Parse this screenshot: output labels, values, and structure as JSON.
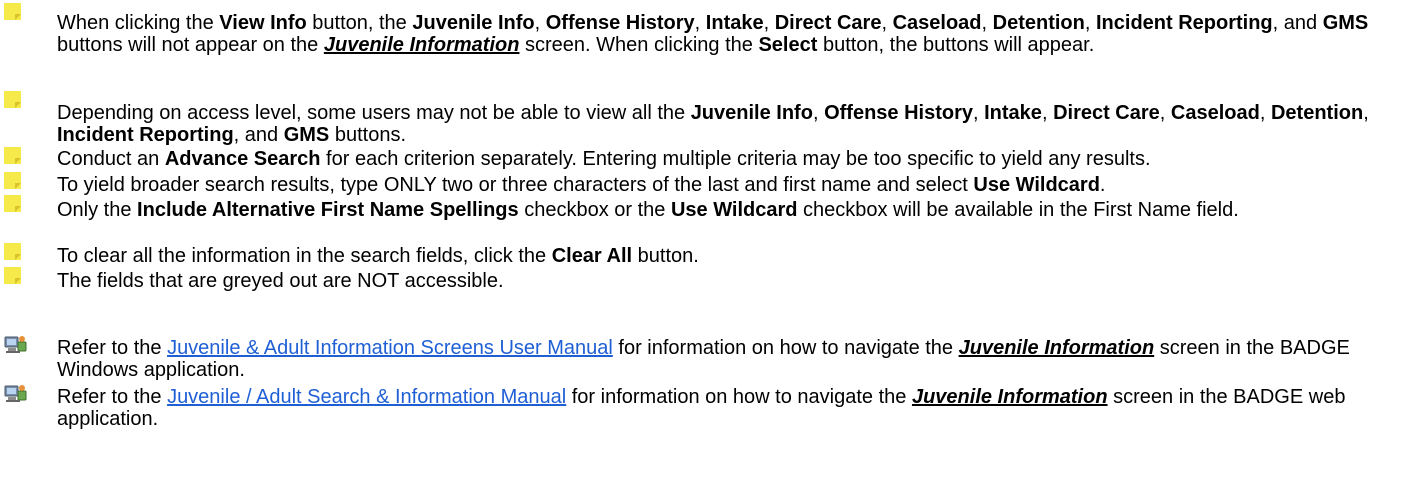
{
  "notes": [
    {
      "icon": "sticky-note-icon",
      "segments": [
        {
          "t": "When clicking the "
        },
        {
          "t": "View Info",
          "s": "b"
        },
        {
          "t": " button, the "
        },
        {
          "t": "Juvenile Info",
          "s": "b"
        },
        {
          "t": ", "
        },
        {
          "t": "Offense History",
          "s": "b"
        },
        {
          "t": ", "
        },
        {
          "t": "Intake",
          "s": "b"
        },
        {
          "t": ", "
        },
        {
          "t": "Direct Care",
          "s": "b"
        },
        {
          "t": ", "
        },
        {
          "t": "Caseload",
          "s": "b"
        },
        {
          "t": ", "
        },
        {
          "t": "Detention",
          "s": "b"
        },
        {
          "t": ", "
        },
        {
          "t": "Incident Reporting",
          "s": "b"
        },
        {
          "t": ", and "
        },
        {
          "t": "GMS",
          "s": "b"
        },
        {
          "t": " buttons will not appear on the "
        },
        {
          "t": "Juvenile Information",
          "s": "iu"
        },
        {
          "t": " screen. When clicking the "
        },
        {
          "t": "Select",
          "s": "b"
        },
        {
          "t": " button, the buttons will appear."
        }
      ]
    },
    {
      "icon": "sticky-note-icon",
      "segments": [
        {
          "t": "Depending on access level, some users may not be able to view all the "
        },
        {
          "t": "Juvenile Info",
          "s": "b"
        },
        {
          "t": ", "
        },
        {
          "t": "Offense History",
          "s": "b"
        },
        {
          "t": ", "
        },
        {
          "t": "Intake",
          "s": "b"
        },
        {
          "t": ", "
        },
        {
          "t": "Direct Care",
          "s": "b"
        },
        {
          "t": ", "
        },
        {
          "t": "Caseload",
          "s": "b"
        },
        {
          "t": ", "
        },
        {
          "t": "Detention",
          "s": "b"
        },
        {
          "t": ", "
        },
        {
          "t": "Incident Reporting",
          "s": "b"
        },
        {
          "t": ", and "
        },
        {
          "t": "GMS",
          "s": "b"
        },
        {
          "t": " buttons."
        }
      ]
    },
    {
      "icon": "sticky-note-icon",
      "segments": [
        {
          "t": "Conduct an "
        },
        {
          "t": "Advance Search",
          "s": "b"
        },
        {
          "t": " for each criterion separately. Entering multiple criteria may be too specific to yield any results."
        }
      ]
    },
    {
      "icon": "sticky-note-icon",
      "segments": [
        {
          "t": "To yield broader search results, type ONLY two or three characters of the last and first name and select "
        },
        {
          "t": "Use Wildcard",
          "s": "b"
        },
        {
          "t": "."
        }
      ]
    },
    {
      "icon": "sticky-note-icon",
      "segments": [
        {
          "t": "Only the "
        },
        {
          "t": "Include Alternative First Name Spellings",
          "s": "b"
        },
        {
          "t": " checkbox or the "
        },
        {
          "t": "Use Wildcard",
          "s": "b"
        },
        {
          "t": " checkbox will be available in the First Name field."
        }
      ]
    },
    {
      "icon": "sticky-note-icon",
      "segments": [
        {
          "t": "To clear all the information in the search fields, click the "
        },
        {
          "t": "Clear All",
          "s": "b"
        },
        {
          "t": " button."
        }
      ]
    },
    {
      "icon": "sticky-note-icon",
      "segments": [
        {
          "t": "The fields that are greyed out are NOT accessible."
        }
      ]
    }
  ],
  "references": [
    {
      "icon": "computer-reference-icon",
      "segments": [
        {
          "t": "Refer to the "
        },
        {
          "t": "Juvenile & Adult Information Screens User Manual",
          "s": "link"
        },
        {
          "t": " for information on how to navigate the "
        },
        {
          "t": "Juvenile Information",
          "s": "iu"
        },
        {
          "t": " screen in the BADGE Windows application."
        }
      ]
    },
    {
      "icon": "computer-reference-icon",
      "segments": [
        {
          "t": "Refer to the "
        },
        {
          "t": "Juvenile / Adult Search & Information Manual",
          "s": "link"
        },
        {
          "t": " for information on how to navigate the "
        },
        {
          "t": "Juvenile Information",
          "s": "iu"
        },
        {
          "t": " screen in the BADGE web application."
        }
      ]
    }
  ],
  "colors": {
    "link": "#1f5fd6",
    "note_icon_fill": "#f6e94a",
    "note_icon_fold": "#d9c22a"
  }
}
